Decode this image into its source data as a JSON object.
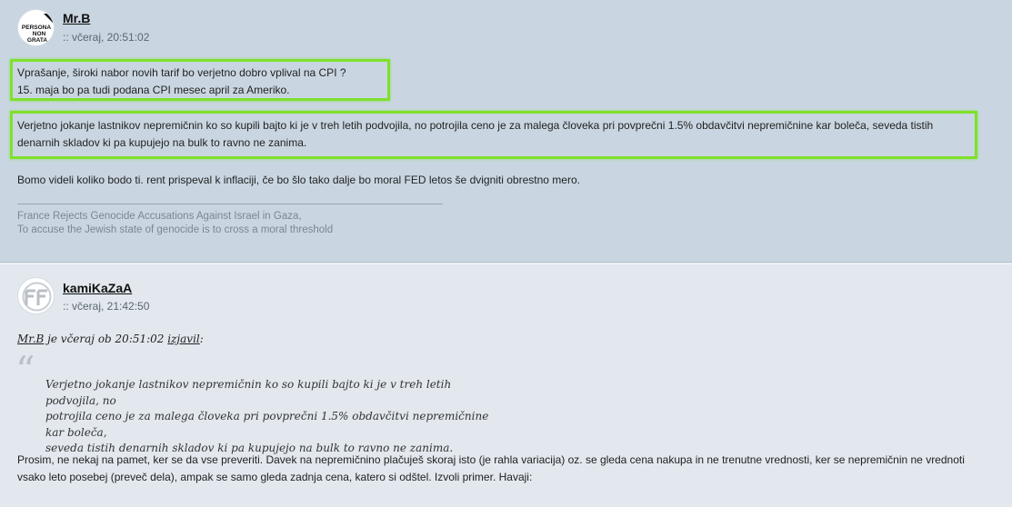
{
  "posts": [
    {
      "username": "Mr.B",
      "timestamp": ":: včeraj, 20:51:02",
      "avatar_text": [
        "PERSONA",
        "NON",
        "GRATA"
      ],
      "para1_line1": "Vprašanje, široki nabor novih tarif bo verjetno dobro vplival na CPI ?",
      "para1_line2": "15. maja bo pa tudi podana CPI mesec april za Ameriko.",
      "para2_line1": "Verjetno jokanje lastnikov nepremičnin ko so kupili bajto ki je v treh letih podvojila, no potrojila ceno je za malega človeka pri povprečni 1.5% obdavčitvi nepremičnine kar boleča, seveda tistih",
      "para2_line2": "denarnih skladov ki pa kupujejo na bulk to ravno ne zanima.",
      "para3": "Bomo videli koliko bodo ti. rent prispeval k inflaciji, če bo šlo tako dalje bo moral FED letos še dvigniti obrestno mero.",
      "signature_line1": "France Rejects Genocide Accusations Against Israel in Gaza,",
      "signature_line2": "To accuse the Jewish state of genocide is to cross a moral threshold"
    },
    {
      "username": "kamiKaZaA",
      "timestamp": ":: včeraj, 21:42:50",
      "quote_author": "Mr.B",
      "quote_mid": " je včeraj ob 20:51:02 ",
      "quote_link": "izjavil",
      "quote_end": ":",
      "quote_line1": "Verjetno jokanje lastnikov nepremičnin ko so kupili bajto ki je v treh letih podvojila, no",
      "quote_line2": "potrojila ceno je za malega človeka pri povprečni 1.5% obdavčitvi nepremičnine kar boleča,",
      "quote_line3": "seveda tistih denarnih skladov ki pa kupujejo na bulk to ravno ne zanima.",
      "reply_line1": "Prosim, ne nekaj na pamet, ker se da vse preveriti. Davek na nepremičnino plačuješ skoraj isto (je rahla variacija) oz. se gleda cena nakupa in ne trenutne vrednosti, ker se nepremičnin ne vrednoti",
      "reply_line2": "vsako leto posebej (preveč dela), ampak se samo gleda zadnja cena, katero si odštel. Izvoli primer. Havaji:"
    }
  ],
  "colors": {
    "highlight": "#7ee02c",
    "post1_bg": "#c9d6e1",
    "post2_bg": "#e2e8ee"
  }
}
